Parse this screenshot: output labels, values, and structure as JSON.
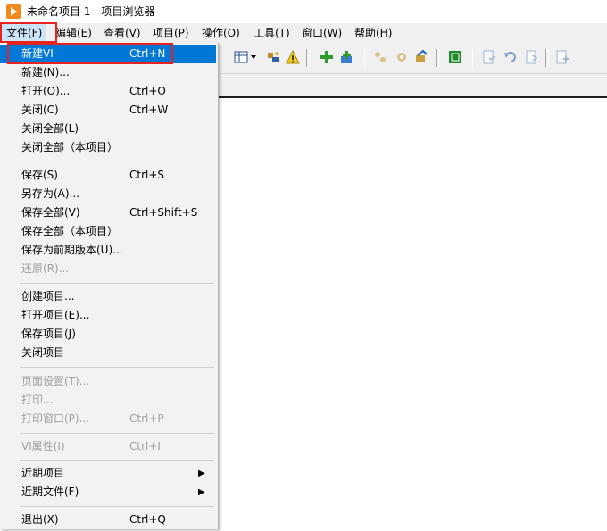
{
  "window": {
    "title": "未命名项目 1 - 项目浏览器"
  },
  "menubar": [
    "文件(F)",
    "编辑(E)",
    "查看(V)",
    "项目(P)",
    "操作(O)",
    "工具(T)",
    "窗口(W)",
    "帮助(H)"
  ],
  "file_menu": {
    "items": [
      {
        "label": "新建VI",
        "shortcut": "Ctrl+N"
      },
      {
        "label": "新建(N)...",
        "shortcut": ""
      },
      {
        "label": "打开(O)...",
        "shortcut": "Ctrl+O"
      },
      {
        "label": "关闭(C)",
        "shortcut": "Ctrl+W"
      },
      {
        "label": "关闭全部(L)",
        "shortcut": ""
      },
      {
        "label": "关闭全部（本项目）",
        "shortcut": ""
      },
      {
        "label": "保存(S)",
        "shortcut": "Ctrl+S"
      },
      {
        "label": "另存为(A)...",
        "shortcut": ""
      },
      {
        "label": "保存全部(V)",
        "shortcut": "Ctrl+Shift+S"
      },
      {
        "label": "保存全部（本项目）",
        "shortcut": ""
      },
      {
        "label": "保存为前期版本(U)...",
        "shortcut": ""
      },
      {
        "label": "还原(R)...",
        "shortcut": ""
      },
      {
        "label": "创建项目...",
        "shortcut": ""
      },
      {
        "label": "打开项目(E)...",
        "shortcut": ""
      },
      {
        "label": "保存项目(J)",
        "shortcut": ""
      },
      {
        "label": "关闭项目",
        "shortcut": ""
      },
      {
        "label": "页面设置(T)...",
        "shortcut": ""
      },
      {
        "label": "打印...",
        "shortcut": ""
      },
      {
        "label": "打印窗口(P)...",
        "shortcut": "Ctrl+P"
      },
      {
        "label": "VI属性(I)",
        "shortcut": "Ctrl+I"
      },
      {
        "label": "近期项目",
        "shortcut": ""
      },
      {
        "label": "近期文件(F)",
        "shortcut": ""
      },
      {
        "label": "退出(X)",
        "shortcut": "Ctrl+Q"
      }
    ]
  },
  "colors": {
    "highlight_box": "#e8231f",
    "selection": "#0078d7",
    "logo": "#f08a1c"
  }
}
